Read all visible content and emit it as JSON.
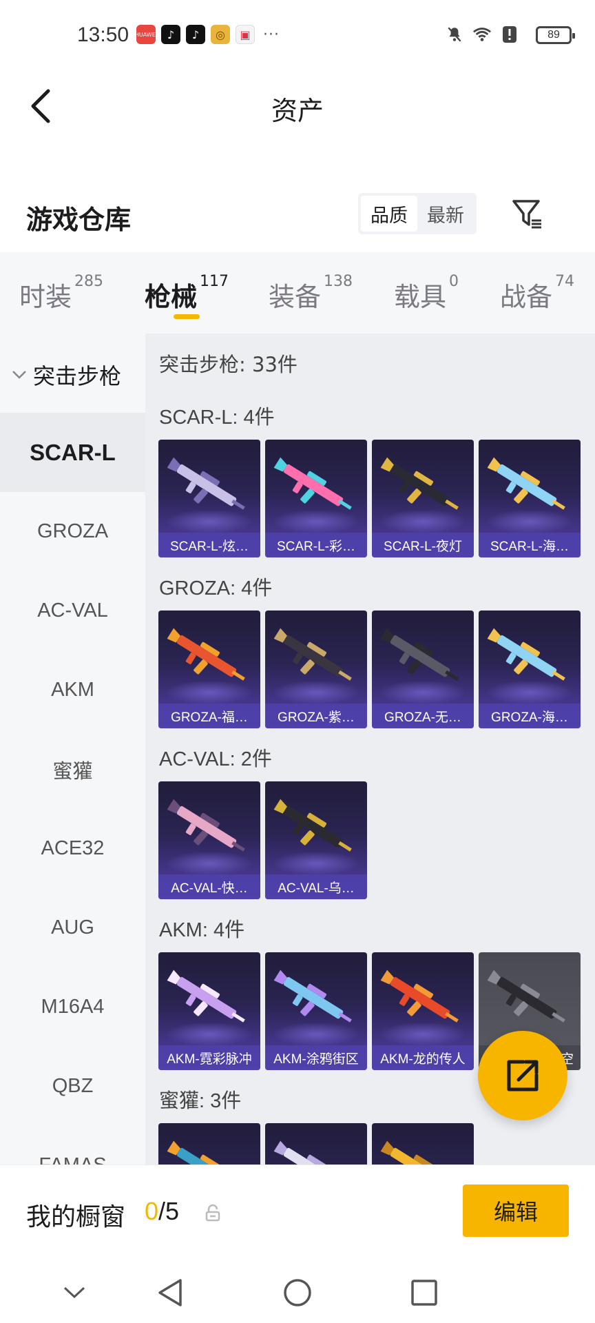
{
  "status_bar": {
    "time": "13:50",
    "battery": "89",
    "more": "···",
    "notif_brand": "HUAWEI"
  },
  "header": {
    "title": "资产"
  },
  "warehouse": {
    "title": "游戏仓库",
    "sort_options": [
      "品质",
      "最新"
    ],
    "active_sort": "品质"
  },
  "tabs": [
    {
      "label": "时装",
      "count": "285"
    },
    {
      "label": "枪械",
      "count": "117"
    },
    {
      "label": "装备",
      "count": "138"
    },
    {
      "label": "载具",
      "count": "0"
    },
    {
      "label": "战备",
      "count": "74"
    }
  ],
  "sidebar": {
    "group": "突击步枪",
    "items": [
      "SCAR-L",
      "GROZA",
      "AC-VAL",
      "AKM",
      "蜜獾",
      "ACE32",
      "AUG",
      "M16A4",
      "QBZ",
      "FAMAS"
    ],
    "active": "SCAR-L"
  },
  "content": {
    "total": "突击步枪: 33件",
    "groups": [
      {
        "label": "SCAR-L: 4件",
        "items": [
          "SCAR-L-炫…",
          "SCAR-L-彩…",
          "SCAR-L-夜灯",
          "SCAR-L-海…"
        ]
      },
      {
        "label": "GROZA: 4件",
        "items": [
          "GROZA-福…",
          "GROZA-紫…",
          "GROZA-无…",
          "GROZA-海…"
        ]
      },
      {
        "label": "AC-VAL: 2件",
        "items": [
          "AC-VAL-快…",
          "AC-VAL-乌…"
        ]
      },
      {
        "label": "AKM: 4件",
        "items": [
          "AKM-霓彩脉冲",
          "AKM-涂鸦街区",
          "AKM-龙的传人",
          "空"
        ]
      },
      {
        "label": "蜜獾: 3件",
        "items": [
          "",
          "",
          ""
        ]
      }
    ]
  },
  "showcase": {
    "label": "我的橱窗",
    "current": "0",
    "total": "/5",
    "edit_label": "编辑"
  },
  "colors": {
    "accent": "#f7b500",
    "tile_caption": "#4e40aa",
    "tile_bg": "#2a2452"
  }
}
